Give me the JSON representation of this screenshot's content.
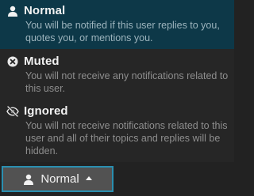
{
  "notification_menu": {
    "options": [
      {
        "title": "Normal",
        "description": "You will be notified if this user replies to you, quotes you, or mentions you.",
        "icon": "user-icon",
        "selected": true
      },
      {
        "title": "Muted",
        "description": "You will not receive any notifications related to this user.",
        "icon": "times-circle-icon",
        "selected": false
      },
      {
        "title": "Ignored",
        "description": "You will not receive notifications related to this user and all of their topics and replies will be hidden.",
        "icon": "eye-slash-icon",
        "selected": false
      }
    ]
  },
  "trigger_button": {
    "label": "Normal",
    "icon": "user-icon",
    "caret": "caret-up-icon"
  },
  "colors": {
    "background": "#222222",
    "menu_background": "#262626",
    "selected_background": "#0d3848",
    "button_background": "#525252",
    "focus_border": "#2a8fb0",
    "title_text": "#f2f2f2",
    "description_text": "#8e8e8e"
  }
}
